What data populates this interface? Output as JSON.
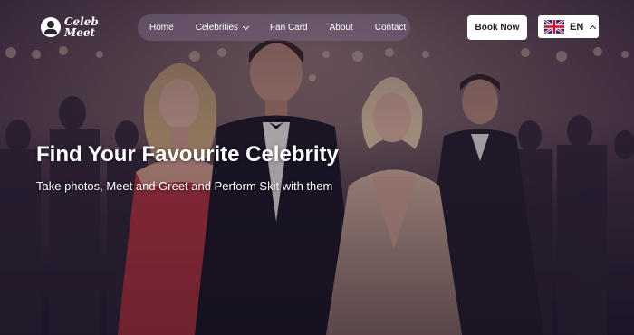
{
  "brand": {
    "line1": "Celeb",
    "line2": "Meet"
  },
  "nav": {
    "items": [
      {
        "label": "Home"
      },
      {
        "label": "Celebrities"
      },
      {
        "label": "Fan Card"
      },
      {
        "label": "About"
      },
      {
        "label": "Contact"
      }
    ]
  },
  "actions": {
    "book_label": "Book Now"
  },
  "language": {
    "code": "EN",
    "flag_icon": "uk-flag-icon"
  },
  "hero": {
    "title": "Find Your Favourite Celebrity",
    "subtitle": "Take photos, Meet and Greet and Perform Skit with them"
  },
  "colors": {
    "menu_bg": "#7a6482",
    "button_bg": "#ffffff",
    "text": "#ffffff",
    "red_dress": "#b8323a"
  }
}
